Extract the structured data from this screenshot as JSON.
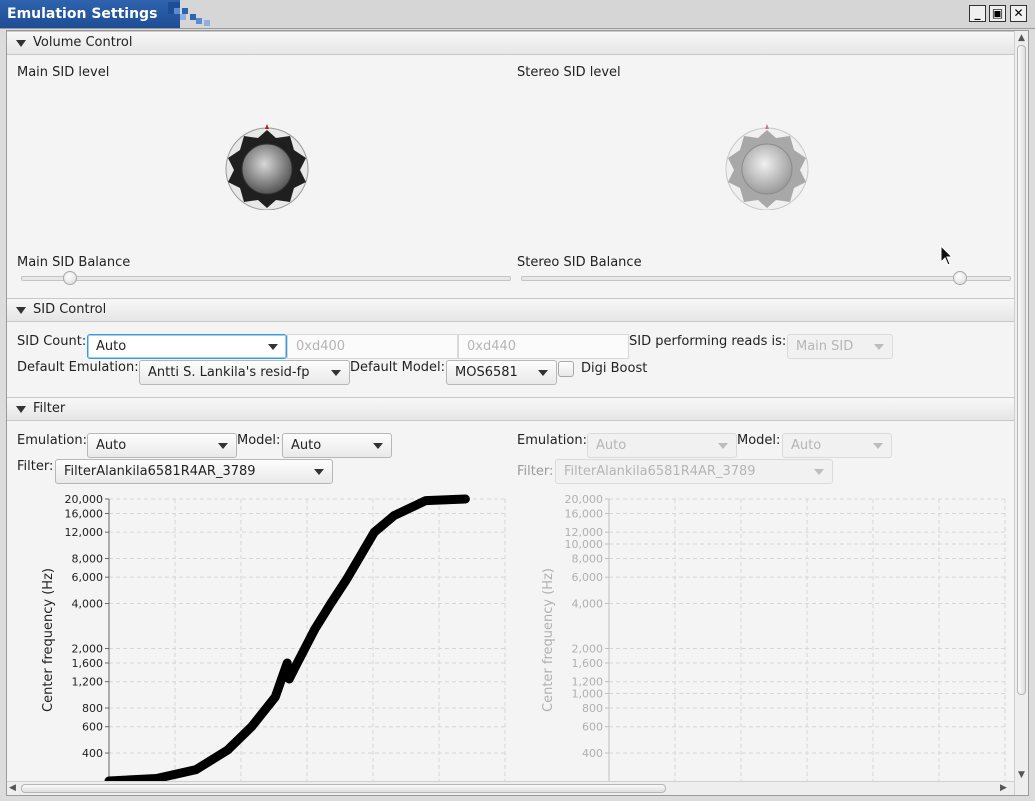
{
  "window": {
    "title": "Emulation Settings"
  },
  "volume": {
    "header": "Volume Control",
    "main_level_label": "Main SID level",
    "stereo_level_label": "Stereo SID level",
    "main_balance_label": "Main SID Balance",
    "stereo_balance_label": "Stereo SID Balance",
    "main_balance": 0.1,
    "stereo_balance": 0.9
  },
  "sid_control": {
    "header": "SID Control",
    "count_label": "SID Count:",
    "count_value": "Auto",
    "stereo_address_placeholder": "0xd400",
    "third_address_placeholder": "0xd440",
    "reads_label": "SID performing reads is:",
    "reads_value": "Main SID",
    "default_emulation_label": "Default Emulation:",
    "default_emulation_value": "Antti S. Lankila's resid-fp",
    "default_model_label": "Default Model:",
    "default_model_value": "MOS6581",
    "digi_boost_label": "Digi Boost",
    "digi_boost_checked": false
  },
  "filter": {
    "header": "Filter",
    "left": {
      "emulation_label": "Emulation:",
      "emulation_value": "Auto",
      "model_label": "Model:",
      "model_value": "Auto",
      "filter_label": "Filter:",
      "filter_value": "FilterAlankila6581R4AR_3789"
    },
    "right": {
      "emulation_label": "Emulation:",
      "emulation_value": "Auto",
      "model_label": "Model:",
      "model_value": "Auto",
      "filter_label": "Filter:",
      "filter_value": "FilterAlankila6581R4AR_3789"
    }
  },
  "chart_data": [
    {
      "type": "line",
      "ylabel": "Center frequency (Hz)",
      "yscale": "log",
      "y_ticks": [
        "400",
        "600",
        "800",
        "1,200",
        "1,600",
        "2,000",
        "4,000",
        "6,000",
        "8,000",
        "12,000",
        "16,000",
        "20,000"
      ],
      "grid": true,
      "series": [
        {
          "x_fraction": [
            0.0,
            0.12,
            0.22,
            0.3,
            0.36,
            0.42,
            0.45,
            0.455,
            0.47,
            0.52,
            0.56,
            0.6,
            0.67,
            0.72,
            0.8,
            0.9
          ],
          "values": [
            260,
            270,
            310,
            420,
            600,
            950,
            1600,
            1250,
            1500,
            2700,
            4000,
            5800,
            12000,
            15500,
            19500,
            20000
          ]
        }
      ]
    },
    {
      "type": "line",
      "ylabel": "Center frequency (Hz)",
      "yscale": "log",
      "y_ticks": [
        "400",
        "600",
        "800",
        "1,000",
        "1,200",
        "1,600",
        "2,000",
        "4,000",
        "6,000",
        "8,000",
        "10,000",
        "12,000",
        "16,000",
        "20,000"
      ],
      "grid": true,
      "disabled": true,
      "series": []
    }
  ],
  "colors": {
    "title_bar": "#1d4d95",
    "focus": "#3a9bd8",
    "curve": "#000000",
    "grid": "#d6d6d6"
  }
}
